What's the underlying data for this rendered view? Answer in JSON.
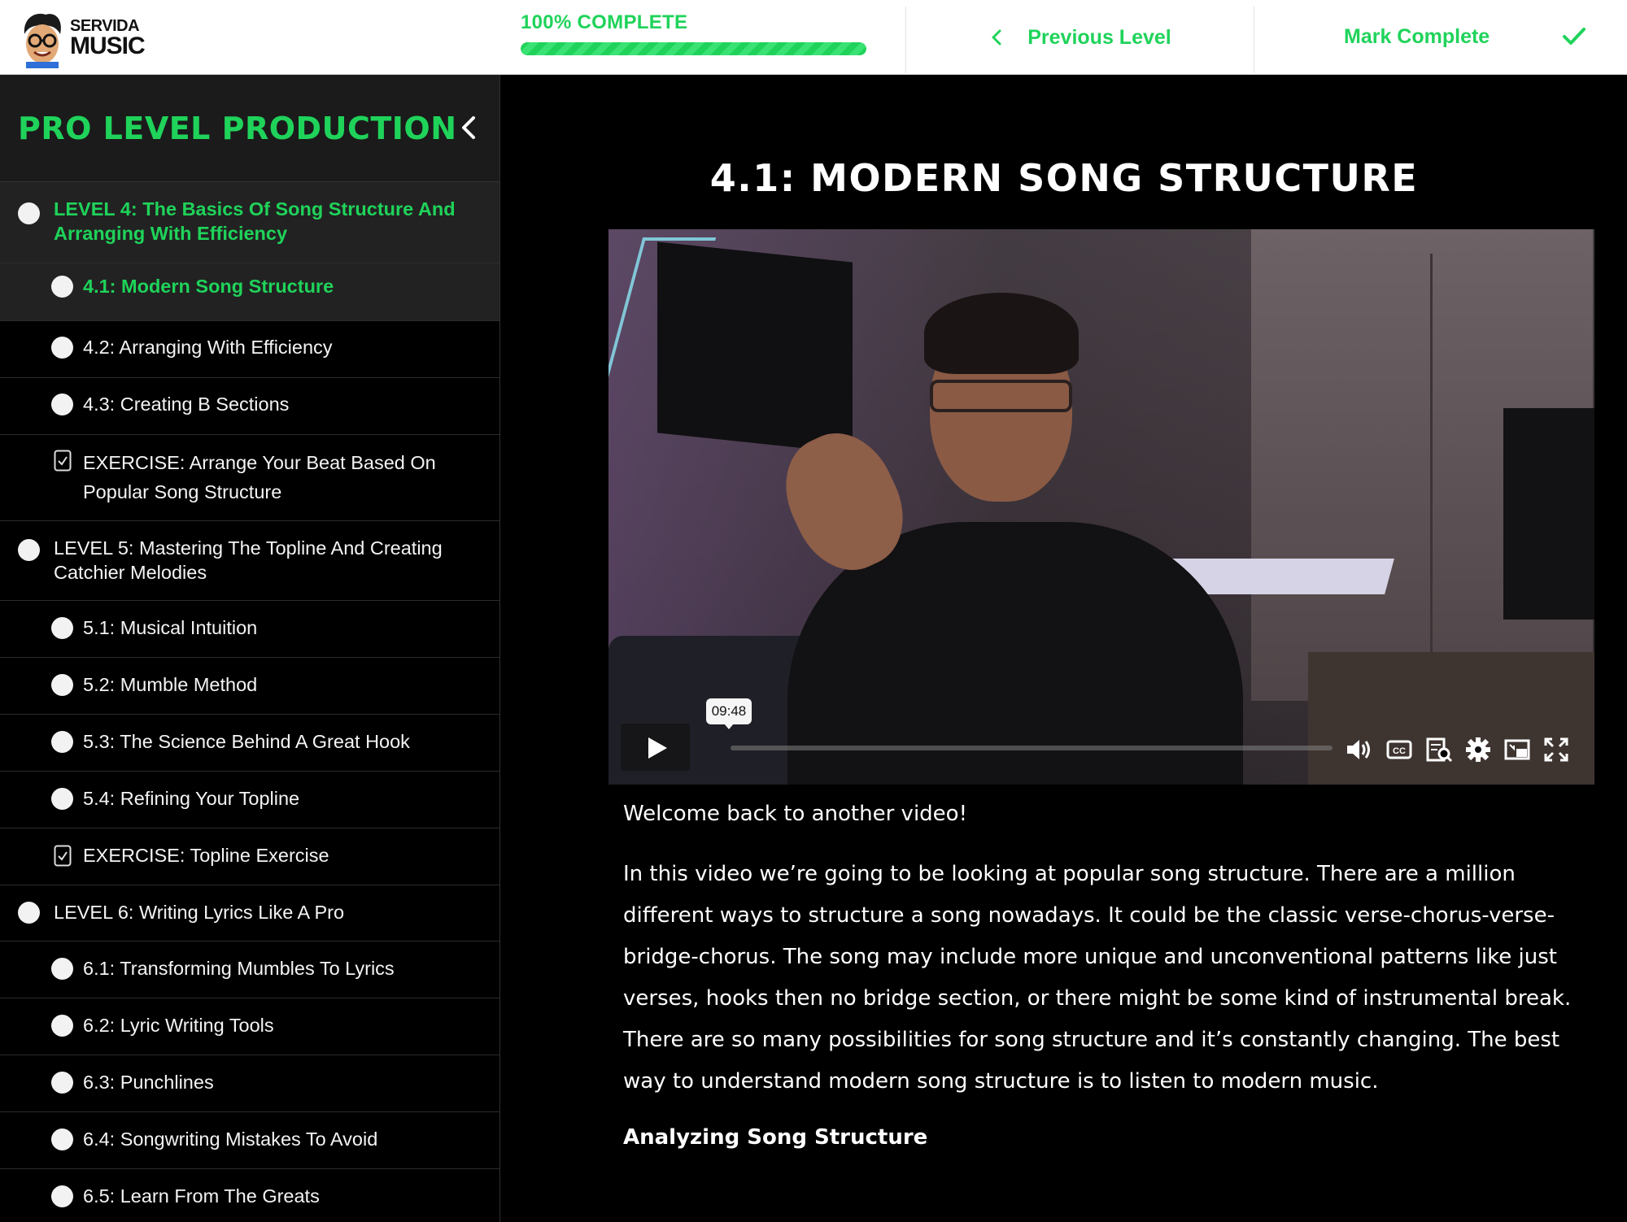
{
  "logo": {
    "line1": "SERVIDA",
    "line2": "MUSIC"
  },
  "progress": {
    "label": "100% COMPLETE",
    "value": 1.0
  },
  "nav": {
    "previous_label": "Previous Level",
    "complete_label": "Mark Complete"
  },
  "colors": {
    "accent": "#1fd35a",
    "background": "#000000",
    "sidebar_active": "#222222"
  },
  "sidebar": {
    "course_title": "PRO LEVEL PRODUCTION",
    "items": [
      {
        "type": "level",
        "label": "LEVEL 4: The Basics Of Song Structure And Arranging With Efficiency",
        "icon": "circle-icon",
        "state": "active"
      },
      {
        "type": "lesson",
        "label": "4.1: Modern Song Structure",
        "icon": "circle-icon",
        "state": "active"
      },
      {
        "type": "lesson",
        "label": "4.2: Arranging With Efficiency",
        "icon": "circle-icon"
      },
      {
        "type": "lesson",
        "label": "4.3: Creating B Sections",
        "icon": "circle-icon"
      },
      {
        "type": "exercise",
        "label": "EXERCISE: Arrange Your Beat Based On Popular Song Structure",
        "icon": "exercise-icon"
      },
      {
        "type": "level",
        "label": "LEVEL 5: Mastering The Topline And Creating Catchier Melodies",
        "icon": "circle-icon"
      },
      {
        "type": "lesson",
        "label": "5.1: Musical Intuition",
        "icon": "circle-icon"
      },
      {
        "type": "lesson",
        "label": "5.2: Mumble Method",
        "icon": "circle-icon"
      },
      {
        "type": "lesson",
        "label": "5.3: The Science Behind A Great Hook",
        "icon": "circle-icon"
      },
      {
        "type": "lesson",
        "label": "5.4: Refining Your Topline",
        "icon": "circle-icon"
      },
      {
        "type": "exercise",
        "label": "EXERCISE: Topline Exercise",
        "icon": "exercise-icon"
      },
      {
        "type": "level",
        "label": "LEVEL 6: Writing Lyrics Like A Pro",
        "icon": "circle-icon"
      },
      {
        "type": "lesson",
        "label": "6.1: Transforming Mumbles To Lyrics",
        "icon": "circle-icon"
      },
      {
        "type": "lesson",
        "label": "6.2: Lyric Writing Tools",
        "icon": "circle-icon"
      },
      {
        "type": "lesson",
        "label": "6.3: Punchlines",
        "icon": "circle-icon"
      },
      {
        "type": "lesson",
        "label": "6.4: Songwriting Mistakes To Avoid",
        "icon": "circle-icon"
      },
      {
        "type": "lesson",
        "label": "6.5: Learn From The Greats",
        "icon": "circle-icon"
      }
    ]
  },
  "main": {
    "lesson_title": "4.1: MODERN SONG STRUCTURE",
    "video": {
      "time_tooltip": "09:48",
      "controls": [
        "play-icon",
        "volume-icon",
        "closed-captions-icon",
        "transcript-icon",
        "settings-gear-icon",
        "picture-in-picture-icon",
        "fullscreen-icon"
      ]
    },
    "description": {
      "welcome": "Welcome back to another video!",
      "body": "In this video we’re going to be looking at popular song structure. There are a million different ways to structure a song nowadays. It could be the classic verse-chorus-verse-bridge-chorus. The song may include more unique and unconventional patterns like just verses, hooks then no bridge section, or there might be some kind of instrumental break. There are so many possibilities for song structure and it’s constantly changing. The best way to understand modern song structure is to listen to modern music.",
      "heading": "Analyzing Song Structure"
    }
  }
}
